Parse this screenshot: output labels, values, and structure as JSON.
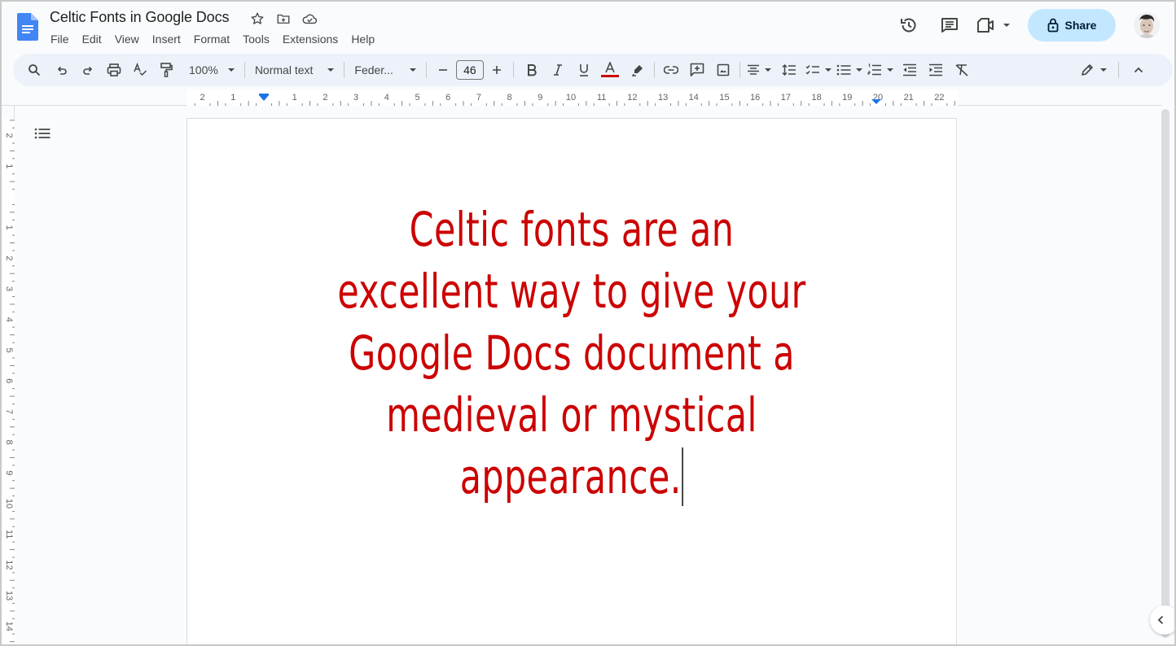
{
  "app": {
    "doc_title": "Celtic Fonts in Google Docs",
    "menu": [
      "File",
      "Edit",
      "View",
      "Insert",
      "Format",
      "Tools",
      "Extensions",
      "Help"
    ],
    "title_icons": [
      "star-icon",
      "move-to-folder-icon",
      "cloud-saved-icon"
    ]
  },
  "header_actions": {
    "history": "version-history-icon",
    "comments": "comments-icon",
    "meet": "meet-camera-icon",
    "share_label": "Share",
    "avatar": "user-avatar"
  },
  "toolbar": {
    "zoom": "100%",
    "style": "Normal text",
    "font": "Feder...",
    "font_size": "46",
    "text_color": "#cc0000",
    "decrease_label": "−",
    "increase_label": "+"
  },
  "ruler": {
    "horizontal_labels_left": [
      "2",
      "1"
    ],
    "horizontal_labels": [
      "1",
      "2",
      "3",
      "4",
      "5",
      "6",
      "7",
      "8",
      "9",
      "10",
      "11",
      "12",
      "13",
      "14",
      "15",
      "16",
      "17",
      "18",
      "19",
      "20",
      "21",
      "22"
    ],
    "vertical_labels": [
      "2",
      "1",
      "1",
      "2",
      "3",
      "4",
      "5",
      "6",
      "7",
      "8",
      "9",
      "10",
      "11",
      "12",
      "13",
      "14"
    ]
  },
  "document": {
    "lines": [
      "Celtic fonts are an",
      "excellent way to give your",
      "Google Docs document a",
      "medieval or mystical",
      "appearance."
    ],
    "text_color": "#cc0000"
  },
  "colors": {
    "accent": "#0b57d0",
    "share_bg": "#c2e7ff",
    "toolbar_bg": "#edf2fa"
  }
}
